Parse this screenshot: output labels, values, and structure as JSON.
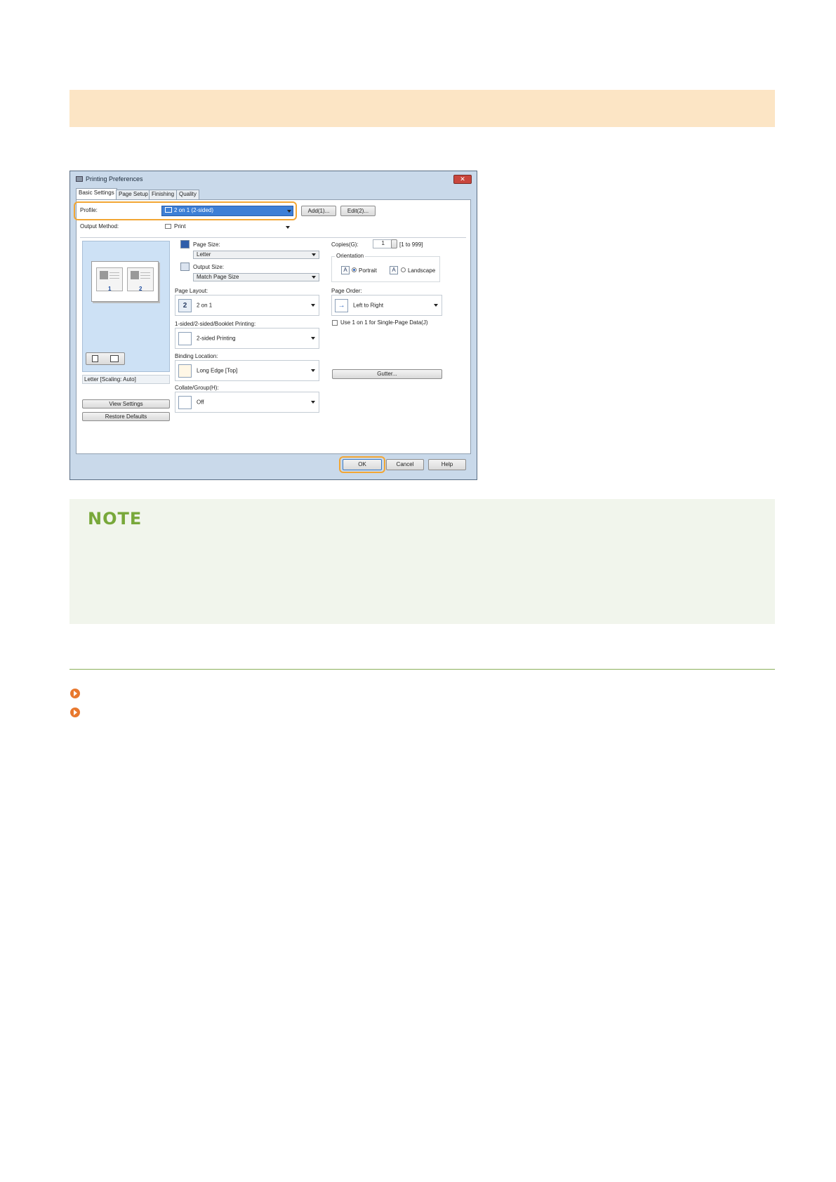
{
  "dialog": {
    "title": "Printing Preferences",
    "close": "✕",
    "tabs": [
      "Basic Settings",
      "Page Setup",
      "Finishing",
      "Quality"
    ],
    "profile_label": "Profile:",
    "profile_value": "2 on 1 (2-sided)",
    "add_button": "Add(1)...",
    "edit_button": "Edit(2)...",
    "output_method_label": "Output Method:",
    "output_method_value": "Print",
    "preview_caption": "Letter [Scaling: Auto]",
    "preview_pages": [
      "1",
      "2"
    ],
    "view_settings": "View Settings",
    "restore_defaults": "Restore Defaults",
    "page_size_label": "Page Size:",
    "page_size_value": "Letter",
    "output_size_label": "Output Size:",
    "output_size_value": "Match Page Size",
    "page_layout_label": "Page Layout:",
    "page_layout_icon": "2",
    "page_layout_value": "2 on 1",
    "duplex_label": "1-sided/2-sided/Booklet Printing:",
    "duplex_value": "2-sided Printing",
    "binding_label": "Binding Location:",
    "binding_value": "Long Edge [Top]",
    "collate_label": "Collate/Group(H):",
    "collate_value": "Off",
    "copies_label": "Copies(G):",
    "copies_value": "1",
    "copies_range": "[1 to 999]",
    "orientation_label": "Orientation",
    "orientation_glyph": "A",
    "portrait": "Portrait",
    "landscape": "Landscape",
    "page_order_label": "Page Order:",
    "page_order_value": "Left to Right",
    "single_page_check": "Use 1 on 1 for Single-Page Data(J)",
    "gutter_button": "Gutter...",
    "ok_button": "OK",
    "cancel_button": "Cancel",
    "help_button": "Help"
  },
  "note": {
    "title": "NOTE"
  },
  "colors": {
    "tan_band": "#fce5c5",
    "note_bg": "#f1f5ec",
    "note_title": "#78a83a",
    "highlight": "#f2a634",
    "bullet": "#e8782e"
  }
}
